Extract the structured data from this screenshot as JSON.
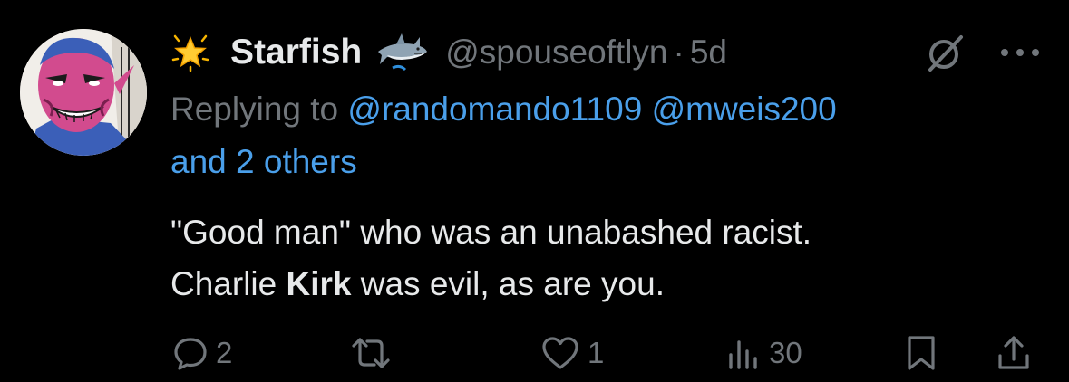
{
  "tweet": {
    "display_name": "Starfish",
    "handle": "@spouseoftlyn",
    "separator": "·",
    "time": "5d",
    "replying_prefix": "Replying to",
    "mention_1": "@randomando1109",
    "mention_2": "@mweis200",
    "mention_others": "and 2 others",
    "text_line1": "\"Good man\" who was an unabashed racist.",
    "text_line2_a": "Charlie ",
    "text_line2_bold": "Kirk",
    "text_line2_b": " was evil, as are you.",
    "name_emoji": "glowing-star-icon",
    "name_badge": "shark-icon"
  },
  "actions": {
    "reply_count": "2",
    "retweet_count": "",
    "like_count": "1",
    "views_count": "30"
  },
  "colors": {
    "background": "#000000",
    "primary_text": "#e7e9ea",
    "secondary_text": "#71767b",
    "link": "#4a9fea"
  }
}
